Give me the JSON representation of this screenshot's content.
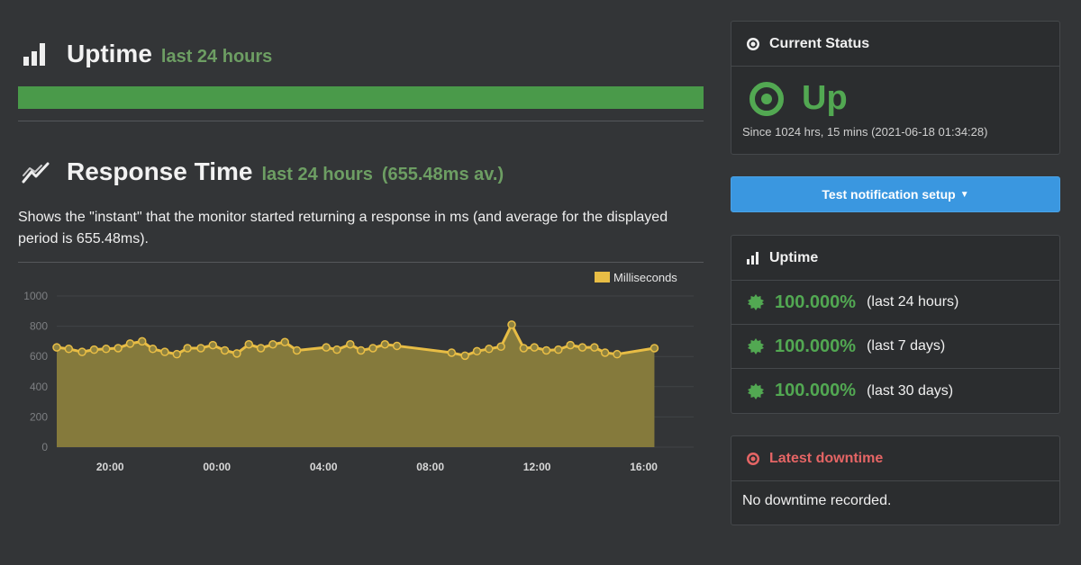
{
  "uptime_section": {
    "icon": "bar-chart-icon",
    "title": "Uptime",
    "subtitle": "last 24 hours",
    "bar_percent": 100
  },
  "response_section": {
    "icon": "line-chart-icon",
    "title": "Response Time",
    "subtitle": "last 24 hours",
    "average": "(655.48ms av.)",
    "description": "Shows the \"instant\" that the monitor started returning a response in ms (and average for the displayed period is 655.48ms)."
  },
  "chart_data": {
    "type": "area",
    "legend": [
      "Milliseconds"
    ],
    "legend_position": "top-right",
    "ylim": [
      0,
      1000
    ],
    "yticks": [
      0,
      200,
      400,
      600,
      800,
      1000
    ],
    "x_ticks": [
      {
        "label": "20:00",
        "t": 1.0
      },
      {
        "label": "00:00",
        "t": 5.0
      },
      {
        "label": "04:00",
        "t": 9.0
      },
      {
        "label": "08:00",
        "t": 13.0
      },
      {
        "label": "12:00",
        "t": 17.0
      },
      {
        "label": "16:00",
        "t": 21.0
      }
    ],
    "x_range": [
      -1.0,
      22.6
    ],
    "series": [
      {
        "name": "Milliseconds",
        "color": "#e8bd45",
        "points": [
          [
            -1.0,
            660
          ],
          [
            -0.55,
            650
          ],
          [
            -0.05,
            630
          ],
          [
            0.4,
            645
          ],
          [
            0.85,
            650
          ],
          [
            1.3,
            655
          ],
          [
            1.75,
            685
          ],
          [
            2.2,
            700
          ],
          [
            2.6,
            650
          ],
          [
            3.05,
            630
          ],
          [
            3.5,
            615
          ],
          [
            3.9,
            655
          ],
          [
            4.4,
            655
          ],
          [
            4.85,
            675
          ],
          [
            5.3,
            640
          ],
          [
            5.75,
            620
          ],
          [
            6.2,
            680
          ],
          [
            6.65,
            655
          ],
          [
            7.1,
            680
          ],
          [
            7.55,
            695
          ],
          [
            8.0,
            640
          ],
          [
            9.1,
            660
          ],
          [
            9.5,
            645
          ],
          [
            10.0,
            680
          ],
          [
            10.4,
            640
          ],
          [
            10.85,
            655
          ],
          [
            11.3,
            680
          ],
          [
            11.75,
            670
          ],
          [
            13.8,
            625
          ],
          [
            14.3,
            605
          ],
          [
            14.75,
            635
          ],
          [
            15.2,
            650
          ],
          [
            15.65,
            665
          ],
          [
            16.05,
            810
          ],
          [
            16.5,
            655
          ],
          [
            16.9,
            660
          ],
          [
            17.35,
            640
          ],
          [
            17.8,
            645
          ],
          [
            18.25,
            675
          ],
          [
            18.7,
            660
          ],
          [
            19.15,
            660
          ],
          [
            19.55,
            625
          ],
          [
            20.0,
            615
          ],
          [
            21.4,
            655
          ]
        ]
      }
    ]
  },
  "current_status": {
    "icon": "target-icon",
    "title": "Current Status",
    "state": "Up",
    "since": "Since 1024 hrs, 15 mins (2021-06-18 01:34:28)",
    "color": "#52a852"
  },
  "notify_button": {
    "label": "Test notification setup",
    "color": "#3a97e0"
  },
  "uptime_panel": {
    "icon": "bar-chart-icon",
    "title": "Uptime",
    "rows": [
      {
        "icon": "badge-icon",
        "percent": "100.000%",
        "period": "(last 24 hours)"
      },
      {
        "icon": "badge-icon",
        "percent": "100.000%",
        "period": "(last 7 days)"
      },
      {
        "icon": "badge-icon",
        "percent": "100.000%",
        "period": "(last 30 days)"
      }
    ]
  },
  "latest_downtime": {
    "icon": "target-icon",
    "title": "Latest downtime",
    "text": "No downtime recorded.",
    "color": "#e56565"
  }
}
